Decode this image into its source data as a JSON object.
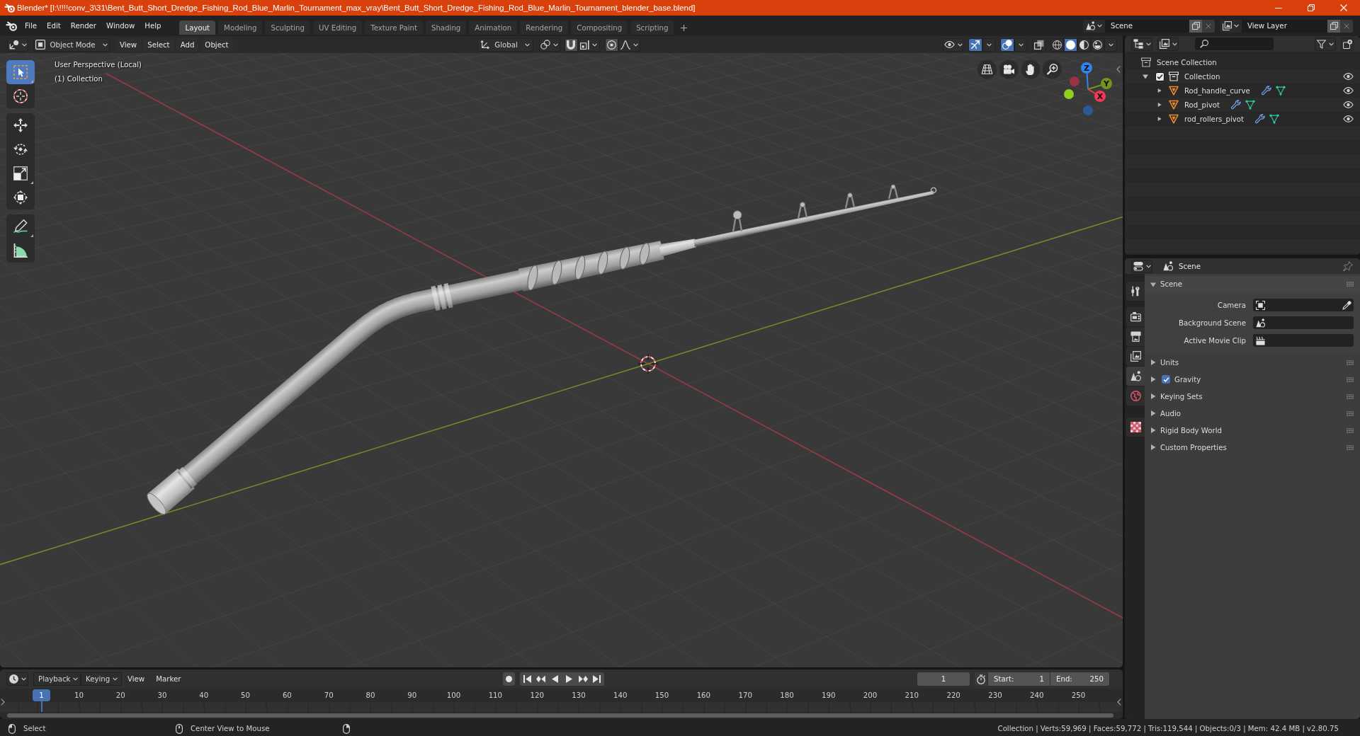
{
  "title_bar": {
    "title": "Blender* [I:\\!!!!conv_3\\31\\Bent_Butt_Short_Dredge_Fishing_Rod_Blue_Marlin_Tournament_max_vray\\Bent_Butt_Short_Dredge_Fishing_Rod_Blue_Marlin_Tournament_blender_base.blend]"
  },
  "top_bar": {
    "menus": [
      "File",
      "Edit",
      "Render",
      "Window",
      "Help"
    ],
    "workspaces": [
      {
        "label": "Layout",
        "selected": true
      },
      {
        "label": "Modeling",
        "selected": false
      },
      {
        "label": "Sculpting",
        "selected": false
      },
      {
        "label": "UV Editing",
        "selected": false
      },
      {
        "label": "Texture Paint",
        "selected": false
      },
      {
        "label": "Shading",
        "selected": false
      },
      {
        "label": "Animation",
        "selected": false
      },
      {
        "label": "Rendering",
        "selected": false
      },
      {
        "label": "Compositing",
        "selected": false
      },
      {
        "label": "Scripting",
        "selected": false
      }
    ],
    "scene": "Scene",
    "view_layer": "View Layer"
  },
  "viewport": {
    "header": {
      "mode": "Object Mode",
      "menus": [
        "View",
        "Select",
        "Add",
        "Object"
      ],
      "orientation": "Global",
      "toggles": [
        {
          "kind": "gizmos",
          "on": true
        },
        {
          "kind": "overlays",
          "on": true
        },
        {
          "kind": "xray",
          "on": false
        }
      ],
      "shading": [
        {
          "kind": "wireframe",
          "selected": false
        },
        {
          "kind": "solid",
          "selected": true
        },
        {
          "kind": "material",
          "selected": false
        },
        {
          "kind": "rendered",
          "selected": false
        }
      ]
    },
    "tools": [
      {
        "kind": "select_box",
        "selected": true
      },
      {
        "kind": "cursor",
        "selected": false
      },
      {
        "kind": "move",
        "selected": false
      },
      {
        "kind": "rotate",
        "selected": false
      },
      {
        "kind": "scale",
        "selected": false
      },
      {
        "kind": "transform",
        "selected": false
      },
      {
        "kind": "annotate",
        "selected": false
      },
      {
        "kind": "measure",
        "selected": false
      }
    ],
    "view_name": "User Perspective (Local)",
    "collection_label": "(1) Collection",
    "gizmo_axes": [
      {
        "kind": "z",
        "label": "Z"
      },
      {
        "kind": "y",
        "label": "Y"
      },
      {
        "kind": "x",
        "label": "X"
      }
    ]
  },
  "outliner": {
    "items": [
      {
        "kind": "scene_collection",
        "label": "Scene Collection",
        "children": [
          {
            "kind": "collection",
            "label": "Collection",
            "expanded": true,
            "checked": true,
            "visible": true,
            "children": [
              {
                "kind": "mesh",
                "label": "Rod_handle_curve",
                "expanded": false,
                "visible": true
              },
              {
                "kind": "mesh",
                "label": "Rod_pivot",
                "expanded": false,
                "visible": true
              },
              {
                "kind": "mesh",
                "label": "rod_rollers_pivot",
                "expanded": false,
                "visible": true
              }
            ]
          }
        ]
      }
    ]
  },
  "properties": {
    "context": "Scene",
    "tabs": [
      {
        "kind": "tool",
        "selected": false
      },
      {
        "kind": "render",
        "selected": false
      },
      {
        "kind": "output",
        "selected": false
      },
      {
        "kind": "view_layer",
        "selected": false
      },
      {
        "kind": "scene",
        "selected": true
      },
      {
        "kind": "world",
        "selected": false
      },
      {
        "kind": "texture",
        "selected": false
      }
    ],
    "panels": [
      {
        "title": "Scene",
        "expanded": true,
        "fields": [
          {
            "label": "Camera",
            "kind": "object"
          },
          {
            "label": "Background Scene",
            "kind": "scene"
          },
          {
            "label": "Active Movie Clip",
            "kind": "clip"
          }
        ]
      },
      {
        "title": "Units",
        "expanded": false
      },
      {
        "title": "Gravity",
        "expanded": false,
        "toggle": {
          "checked": true
        }
      },
      {
        "title": "Keying Sets",
        "expanded": false
      },
      {
        "title": "Audio",
        "expanded": false
      },
      {
        "title": "Rigid Body World",
        "expanded": false
      },
      {
        "title": "Custom Properties",
        "expanded": false
      }
    ]
  },
  "timeline": {
    "menus": [
      {
        "label": "Playback",
        "kind": "dropdown"
      },
      {
        "label": "Keying",
        "kind": "dropdown"
      },
      {
        "label": "View",
        "kind": "menu"
      },
      {
        "label": "Marker",
        "kind": "menu"
      }
    ],
    "auto_keying": {
      "on": false
    },
    "current_frame": "1",
    "start_label": "Start:",
    "start": "1",
    "end_label": "End:",
    "end": "250",
    "playhead": "1",
    "ruler": [
      "10",
      "20",
      "30",
      "40",
      "50",
      "60",
      "70",
      "80",
      "90",
      "100",
      "110",
      "120",
      "130",
      "140",
      "150",
      "160",
      "170",
      "180",
      "190",
      "200",
      "210",
      "220",
      "230",
      "240",
      "250"
    ]
  },
  "status_bar": {
    "hints": [
      "Select",
      "Center View to Mouse"
    ],
    "stats": "Collection | Verts:59,969 | Faces:59,772 | Tris:119,544 | Objects:0/3 | Mem: 42.4 MB | v2.80.75"
  }
}
